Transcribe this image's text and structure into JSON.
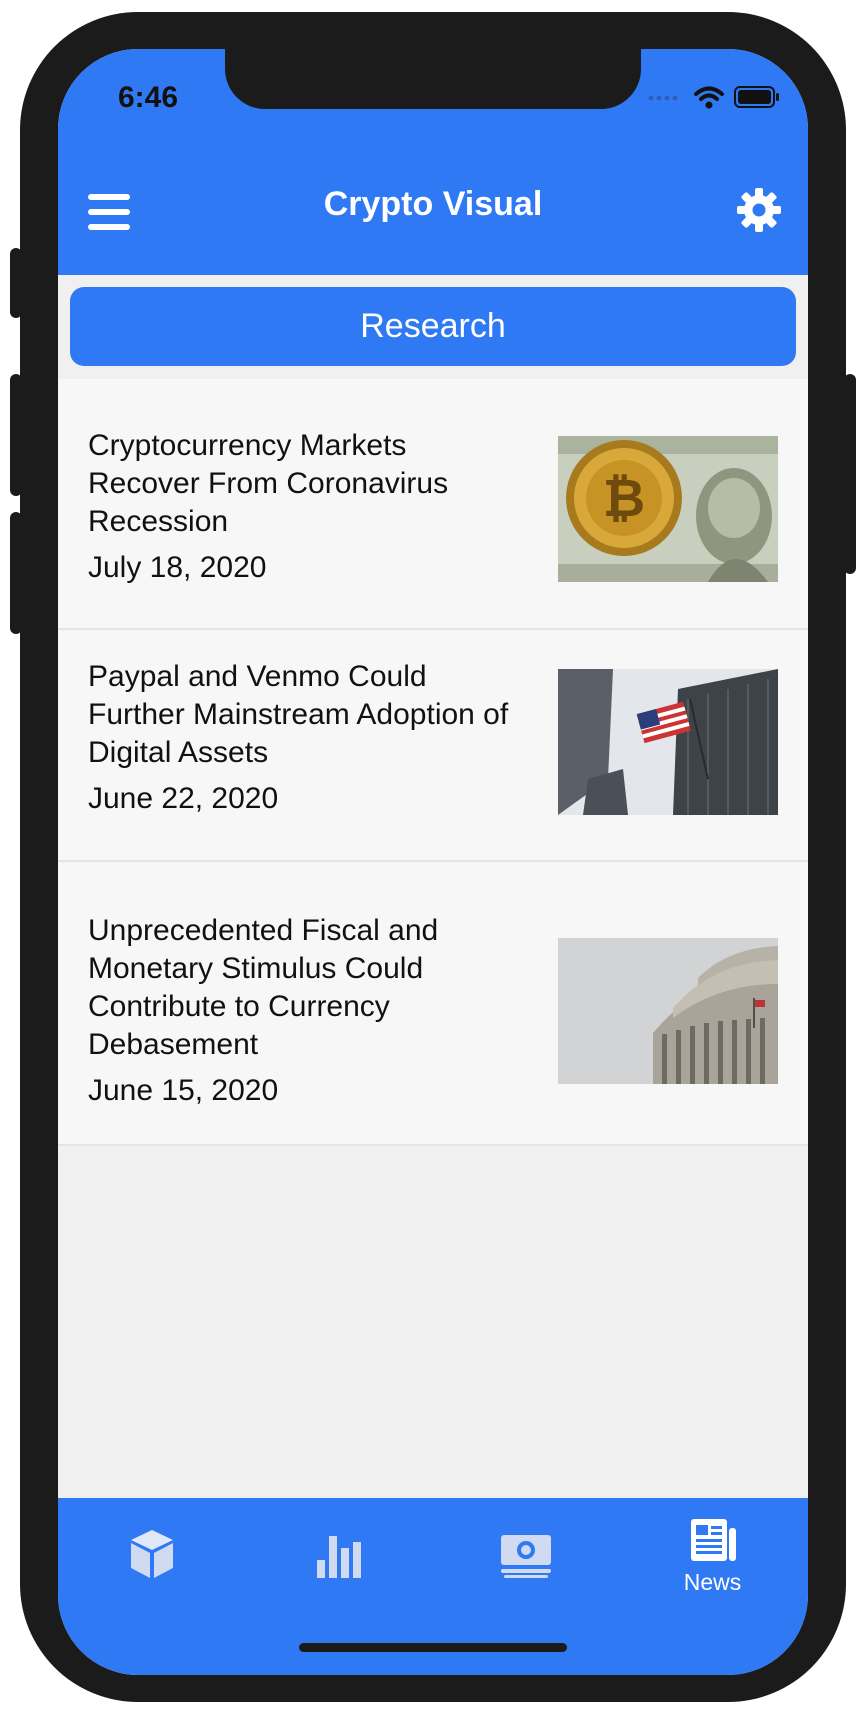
{
  "status": {
    "time": "6:46"
  },
  "navbar": {
    "title": "Crypto Visual"
  },
  "research": {
    "label": "Research"
  },
  "articles": [
    {
      "title": "Cryptocurrency Markets Recover From Coronavirus Recession",
      "date": "July 18, 2020",
      "image": "bitcoin-dollar-image"
    },
    {
      "title": "Paypal and Venmo Could Further Mainstream Adoption of Digital Assets",
      "date": "June 22, 2020",
      "image": "american-flag-building-image"
    },
    {
      "title": "Unprecedented Fiscal and Monetary Stimulus Could Contribute to Currency Debasement",
      "date": "June 15, 2020",
      "image": "capitol-dome-image"
    }
  ],
  "tabbar": {
    "tabs": [
      {
        "icon": "cube-icon",
        "label": ""
      },
      {
        "icon": "bar-chart-icon",
        "label": ""
      },
      {
        "icon": "money-icon",
        "label": ""
      },
      {
        "icon": "newspaper-icon",
        "label": "News"
      }
    ],
    "active": "News"
  },
  "colors": {
    "accent": "#3079f4",
    "background": "#f0f0f0",
    "card": "#f7f7f7"
  }
}
